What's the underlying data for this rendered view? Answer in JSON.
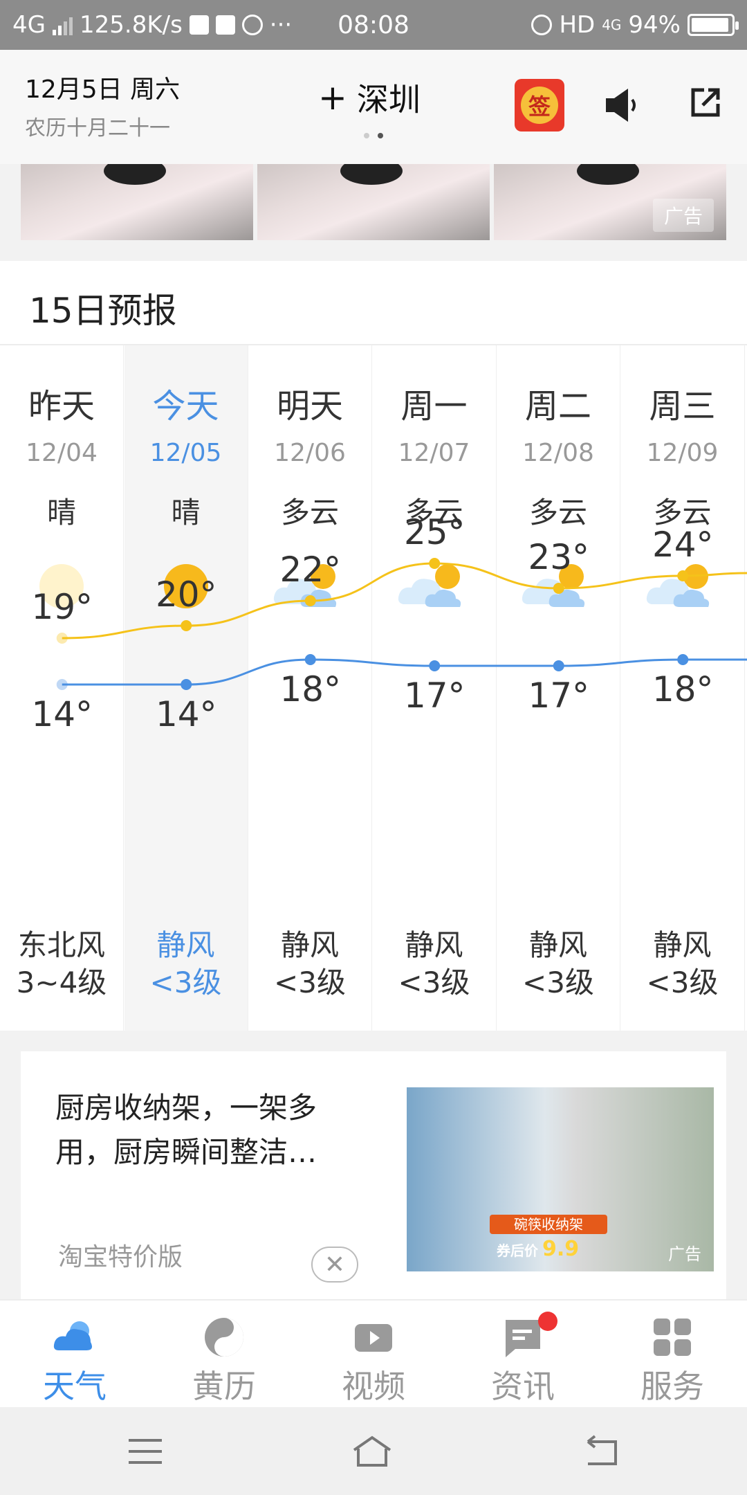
{
  "status_bar": {
    "network": "4G",
    "speed": "125.8K/s",
    "time": "08:08",
    "hd": "HD",
    "net4g": "4G",
    "battery": "94%",
    "battery_level": 0.94
  },
  "header": {
    "date": "12月5日 周六",
    "lunar": "农历十月二十一",
    "city": "深圳",
    "add_symbol": "+",
    "sign_char": "签"
  },
  "top_ad": {
    "badge": "广告"
  },
  "forecast": {
    "title": "15日预报",
    "days": [
      {
        "name": "昨天",
        "date": "12/04",
        "cond": "晴",
        "icon": "sun-faded-icon",
        "high": "19°",
        "low": "14°",
        "wind1": "东北风",
        "wind2": "3~4级"
      },
      {
        "name": "今天",
        "date": "12/05",
        "cond": "晴",
        "icon": "sun-icon",
        "high": "20°",
        "low": "14°",
        "wind1": "静风",
        "wind2": "<3级"
      },
      {
        "name": "明天",
        "date": "12/06",
        "cond": "多云",
        "icon": "partly-cloudy-icon",
        "high": "22°",
        "low": "18°",
        "wind1": "静风",
        "wind2": "<3级"
      },
      {
        "name": "周一",
        "date": "12/07",
        "cond": "多云",
        "icon": "partly-cloudy-icon",
        "high": "25°",
        "low": "17°",
        "wind1": "静风",
        "wind2": "<3级"
      },
      {
        "name": "周二",
        "date": "12/08",
        "cond": "多云",
        "icon": "partly-cloudy-icon",
        "high": "23°",
        "low": "17°",
        "wind1": "静风",
        "wind2": "<3级"
      },
      {
        "name": "周三",
        "date": "12/09",
        "cond": "多云",
        "icon": "partly-cloudy-icon",
        "high": "24°",
        "low": "18°",
        "wind1": "静风",
        "wind2": "<3级"
      }
    ],
    "colors": {
      "high_line": "#f5c21a",
      "low_line": "#4a90e2",
      "today": "#4a90e2"
    }
  },
  "ad_card": {
    "text": "厨房收纳架，一架多用，厨房瞬间整洁…",
    "source": "淘宝特价版",
    "close": "✕",
    "pic_label": "碗筷收纳架",
    "pic_price_prefix": "券后价",
    "pic_price": "9.9",
    "tag": "广告"
  },
  "tabs": [
    {
      "label": "天气",
      "icon": "weather-cloud-icon",
      "active": true
    },
    {
      "label": "黄历",
      "icon": "yin-yang-icon",
      "active": false
    },
    {
      "label": "视频",
      "icon": "video-icon",
      "active": false
    },
    {
      "label": "资讯",
      "icon": "news-icon",
      "active": false,
      "badge": true
    },
    {
      "label": "服务",
      "icon": "services-grid-icon",
      "active": false
    }
  ]
}
